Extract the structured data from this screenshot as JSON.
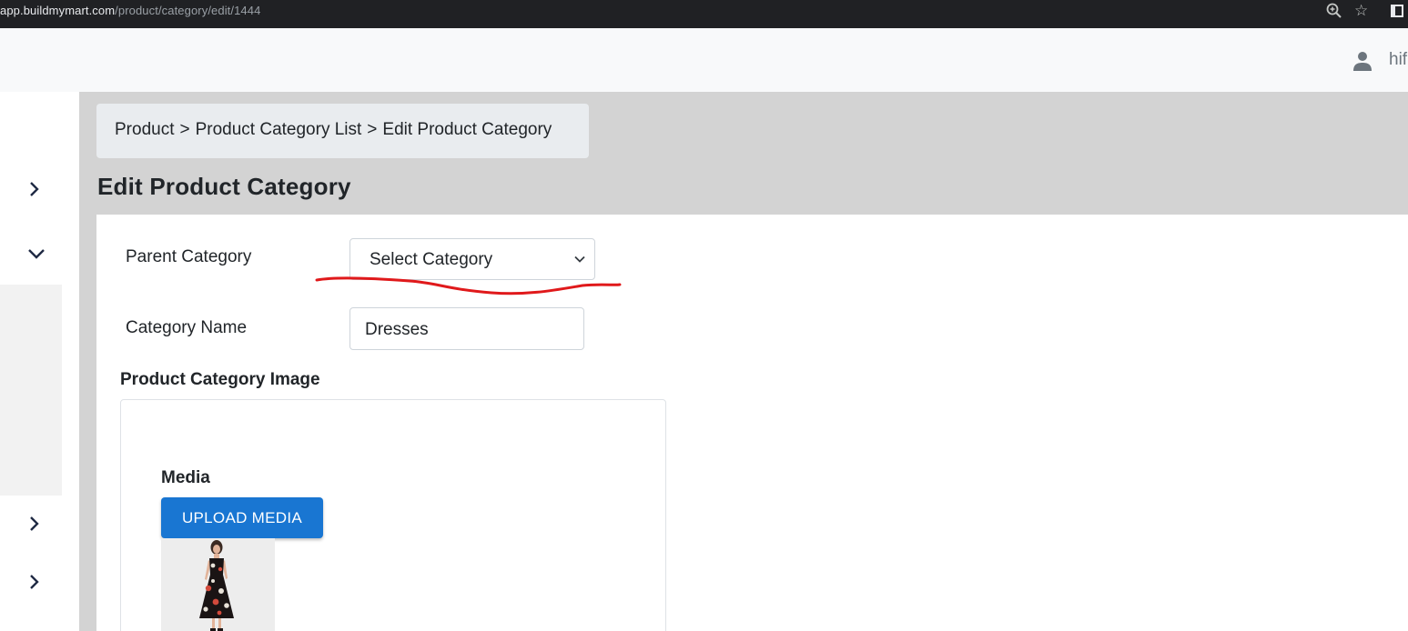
{
  "browser": {
    "url_host": "app.buildmymart.com",
    "url_path": "/product/category/edit/1444",
    "icons": [
      "zoom-icon",
      "star-icon",
      "side-panel-icon"
    ]
  },
  "header": {
    "user_name": "hif",
    "user_icon": "user-icon"
  },
  "sidebar": {
    "items": [
      {
        "icon": "chevron-right-icon"
      },
      {
        "icon": "chevron-down-icon"
      },
      {
        "icon": "chevron-right-icon"
      },
      {
        "icon": "chevron-right-icon"
      }
    ]
  },
  "breadcrumb": {
    "items": [
      "Product",
      "Product Category List",
      "Edit Product Category"
    ],
    "separator": ">"
  },
  "page": {
    "title": "Edit Product Category"
  },
  "form": {
    "parent_category_label": "Parent Category",
    "parent_category_value": "Select Category",
    "category_name_label": "Category Name",
    "category_name_value": "Dresses",
    "image_section_label": "Product Category Image",
    "media_label": "Media",
    "upload_button": "UPLOAD MEDIA"
  },
  "colors": {
    "accent": "#1976d2",
    "annotation": "#e0191b",
    "page_bg": "#d3d3d3"
  }
}
